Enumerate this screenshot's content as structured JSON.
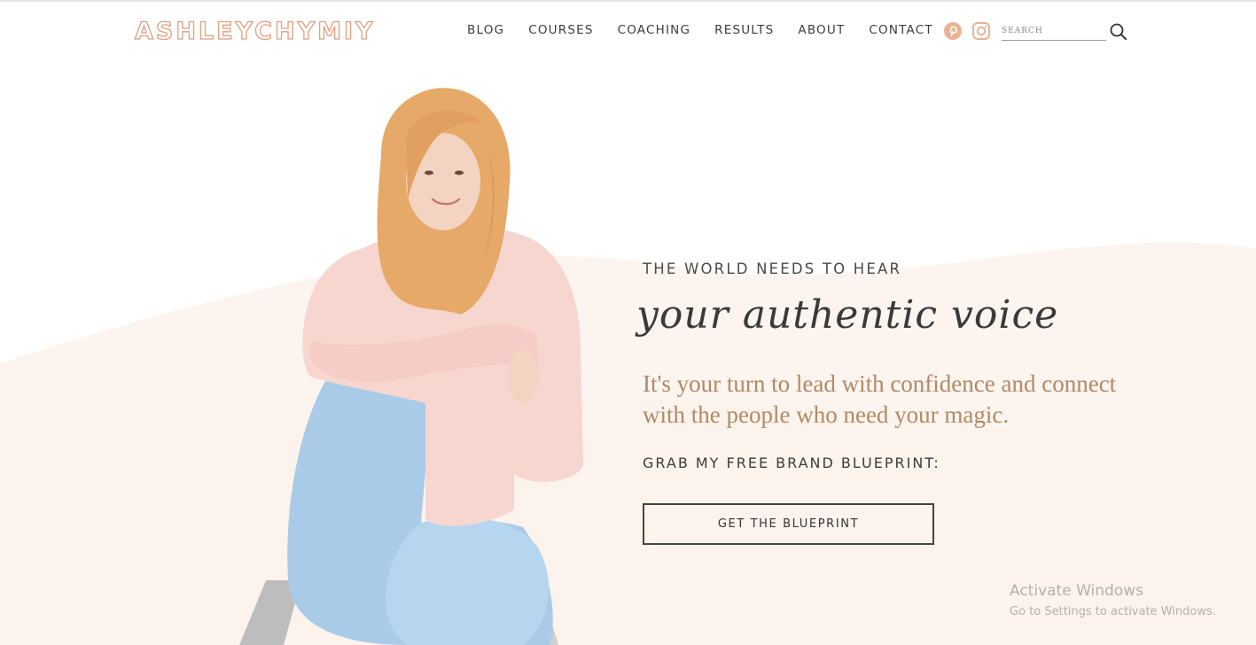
{
  "header": {
    "logo": "ASHLEYCHYMIY",
    "nav": [
      "BLOG",
      "COURSES",
      "COACHING",
      "RESULTS",
      "ABOUT",
      "CONTACT"
    ],
    "social": [
      "pinterest-icon",
      "instagram-icon"
    ],
    "search_placeholder": "SEARCH"
  },
  "hero": {
    "kicker": "THE WORLD NEEDS TO HEAR",
    "script": "your authentic voice",
    "lead": "It's your turn to lead with confidence and connect with the people who need your magic.",
    "grab": "GRAB MY FREE BRAND BLUEPRINT:",
    "cta": "GET THE BLUEPRINT"
  },
  "watermark": {
    "title": "Activate Windows",
    "subtitle": "Go to Settings to activate Windows."
  },
  "colors": {
    "accent": "#e8a883",
    "lead_text": "#b08a65",
    "wave": "#fbf3ee"
  }
}
